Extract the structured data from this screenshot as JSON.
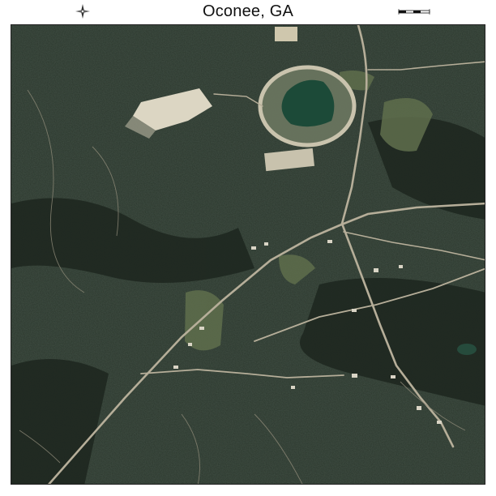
{
  "title": "Oconee, GA",
  "icons": {
    "compass": "north-arrow-icon",
    "scale": "scale-bar-icon"
  },
  "colors": {
    "forest_dark": "#1f2a22",
    "forest_mid": "#2f3c2e",
    "field_green": "#6f7d58",
    "clearing": "#d8d3bf",
    "pond": "#1e4b3a",
    "road": "#b3ab98"
  }
}
